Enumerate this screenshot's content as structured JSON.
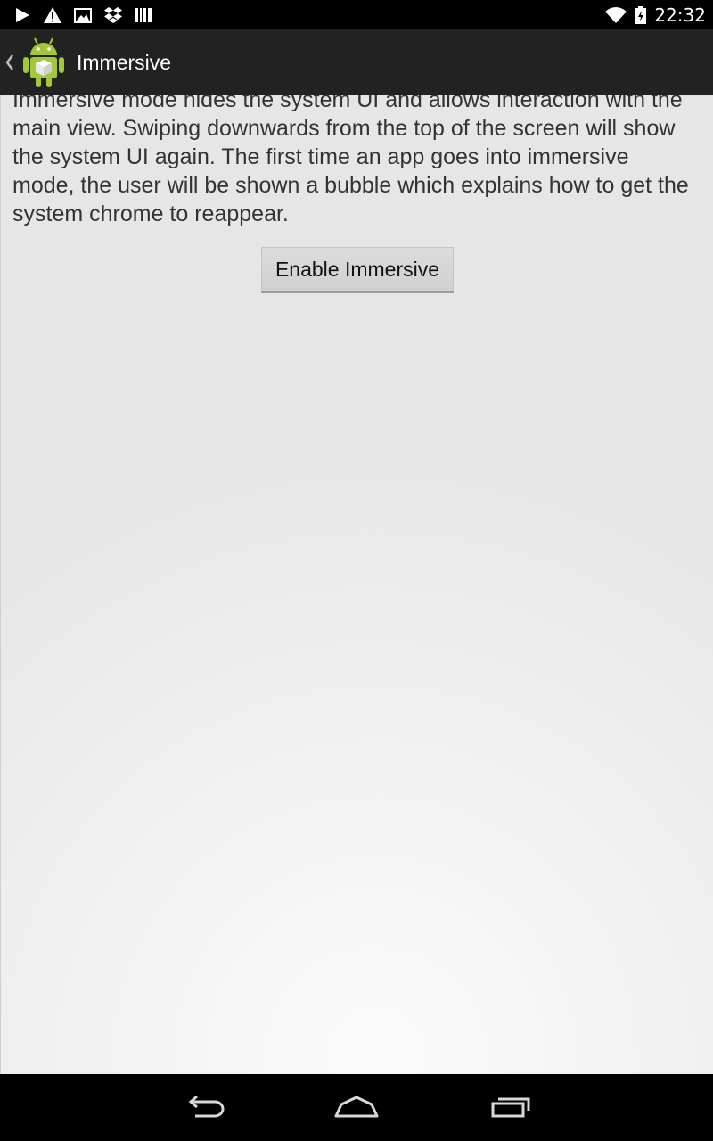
{
  "status_bar": {
    "time": "22:32",
    "left_icons": [
      "play-icon",
      "warning-icon",
      "image-icon",
      "dropbox-icon",
      "barcode-icon"
    ],
    "right_icons": [
      "wifi-icon",
      "battery-icon"
    ]
  },
  "action_bar": {
    "title": "Immersive",
    "app_icon": "android-robot-icon"
  },
  "content": {
    "description": "Immersive mode hides the system UI and allows interaction with the main view. Swiping downwards from the top of the screen will show the system UI again. The first time an app goes into immersive mode, the user will be shown a bubble which explains how to get the system chrome to reappear.",
    "enable_button_label": "Enable Immersive"
  },
  "nav_bar": {
    "buttons": [
      "back-icon",
      "home-icon",
      "recents-icon"
    ]
  },
  "colors": {
    "status_bar": "#000000",
    "action_bar": "#222222",
    "content_background": "#eeeeee",
    "text": "#333333",
    "button": "#d6d6d6",
    "android_green": "#a4c639"
  }
}
